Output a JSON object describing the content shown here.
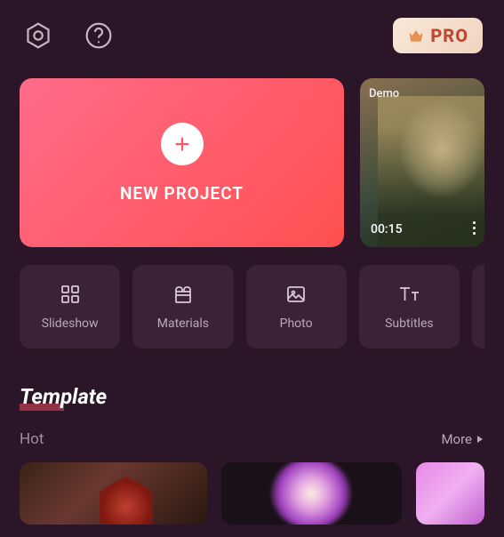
{
  "topBar": {
    "proLabel": "PRO"
  },
  "newProject": {
    "label": "NEW PROJECT"
  },
  "demo": {
    "tag": "Demo",
    "duration": "00:15"
  },
  "tiles": [
    {
      "label": "Slideshow"
    },
    {
      "label": "Materials"
    },
    {
      "label": "Photo"
    },
    {
      "label": "Subtitles"
    }
  ],
  "templates": {
    "heading": "Template",
    "categoryLabel": "Hot",
    "moreLabel": "More"
  }
}
